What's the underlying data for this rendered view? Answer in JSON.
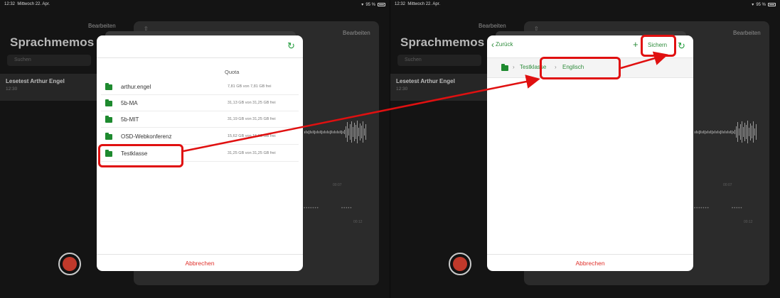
{
  "status": {
    "time": "12:32",
    "date": "Mittwoch 22. Apr.",
    "battery": "95 %"
  },
  "app": {
    "edit_label": "Bearbeiten",
    "title": "Sprachmemos",
    "search_placeholder": "Suchen",
    "recording": {
      "title": "Lesetest Arthur Engel",
      "time": "12:30"
    },
    "wave_labels": [
      "00:07",
      "00:12"
    ],
    "ctrl_dash": [
      "•••••••",
      "•••••"
    ]
  },
  "left_dialog": {
    "quota_header": "Quota",
    "folders": [
      {
        "name": "arthur.engel",
        "quota": "7,81 GB von 7,81 GB frei"
      },
      {
        "name": "5b-MA",
        "quota": "31,13 GB von 31,25 GB frei"
      },
      {
        "name": "5b-MIT",
        "quota": "31,19 GB von 31,25 GB frei"
      },
      {
        "name": "OSD-Webkonferenz",
        "quota": "15,62 GB von 15,63 GB frei"
      },
      {
        "name": "Testklasse",
        "quota": "31,25 GB von 31,25 GB frei"
      }
    ],
    "cancel_label": "Abbrechen"
  },
  "right_dialog": {
    "back_label": "Zurück",
    "plus_label": "+",
    "save_label": "Sichern",
    "breadcrumb": [
      "Testklasse",
      "Englisch"
    ],
    "cancel_label": "Abbrechen"
  },
  "colors": {
    "annotation": "#e01010",
    "accent": "#2d8c3b",
    "cancel": "#e0312b",
    "record": "#c0392b"
  }
}
